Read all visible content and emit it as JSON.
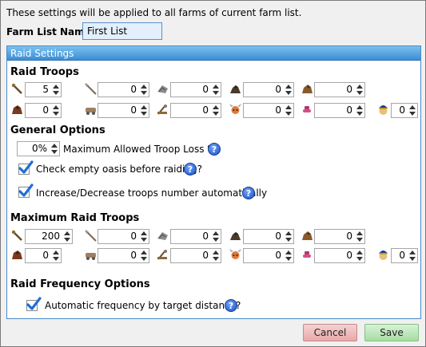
{
  "intro_text": "These settings will be applied to all farms of current farm list.",
  "farm_list": {
    "label": "Farm List Name:",
    "value": "First List"
  },
  "panel_title": "Raid Settings",
  "raid_troops": {
    "title": "Raid Troops",
    "row1": [
      {
        "icon": "clubswinger-icon",
        "value": "5"
      },
      {
        "icon": "spearman-icon",
        "value": "0"
      },
      {
        "icon": "axeman-icon",
        "value": "0"
      },
      {
        "icon": "scout-icon",
        "value": "0"
      },
      {
        "icon": "paladin-icon",
        "value": "0"
      }
    ],
    "row2": [
      {
        "icon": "teutonic-knight-icon",
        "value": "0"
      },
      {
        "icon": "ram-icon",
        "value": "0"
      },
      {
        "icon": "catapult-icon",
        "value": "0"
      },
      {
        "icon": "chief-icon",
        "value": "0"
      },
      {
        "icon": "settler-icon",
        "value": "0"
      },
      {
        "icon": "hero-icon",
        "value": "0"
      }
    ]
  },
  "general_options": {
    "title": "General Options",
    "loss_value": "0%",
    "loss_label": "Maximum Allowed Troop Loss %",
    "check_oasis_label": "Check empty oasis before raiding?",
    "auto_troops_label": "Increase/Decrease troops number automatically",
    "check_oasis_checked": true,
    "auto_troops_checked": true
  },
  "max_raid_troops": {
    "title": "Maximum Raid Troops",
    "row1": [
      {
        "icon": "clubswinger-icon",
        "value": "200"
      },
      {
        "icon": "spearman-icon",
        "value": "0"
      },
      {
        "icon": "axeman-icon",
        "value": "0"
      },
      {
        "icon": "scout-icon",
        "value": "0"
      },
      {
        "icon": "paladin-icon",
        "value": "0"
      }
    ],
    "row2": [
      {
        "icon": "teutonic-knight-icon",
        "value": "0"
      },
      {
        "icon": "ram-icon",
        "value": "0"
      },
      {
        "icon": "catapult-icon",
        "value": "0"
      },
      {
        "icon": "chief-icon",
        "value": "0"
      },
      {
        "icon": "settler-icon",
        "value": "0"
      },
      {
        "icon": "hero-icon",
        "value": "0"
      }
    ]
  },
  "frequency": {
    "title": "Raid Frequency Options",
    "auto_label": "Automatic frequency by target distance?",
    "auto_checked": true
  },
  "buttons": {
    "cancel": "Cancel",
    "save": "Save"
  },
  "help_glyph": "?",
  "colors": {
    "accent": "#3b8ed6",
    "check": "#1e6fd6",
    "cancel_bg": "#e9a9a9",
    "save_bg": "#a8dca4"
  }
}
